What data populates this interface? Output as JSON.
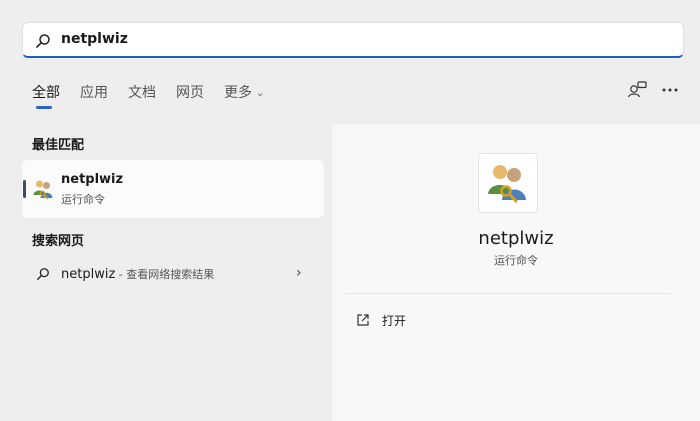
{
  "search": {
    "query": "netplwiz",
    "icon": "search-icon"
  },
  "tabs": [
    {
      "label": "全部",
      "active": true
    },
    {
      "label": "应用"
    },
    {
      "label": "文档"
    },
    {
      "label": "网页"
    },
    {
      "label": "更多",
      "chevron": "chevron-down-icon"
    }
  ],
  "toolbar": {
    "icons": [
      "accounts-icon",
      "more-options-icon"
    ]
  },
  "best_match": {
    "header": "最佳匹配",
    "item": {
      "title": "netplwiz",
      "subtitle": "运行命令",
      "icon": "user-accounts-icon"
    }
  },
  "web_search": {
    "header": "搜索网页",
    "item": {
      "query": "netplwiz",
      "suffix": " - 查看网络搜索结果",
      "icon": "search-icon",
      "chevron": "chevron-right-icon"
    }
  },
  "detail": {
    "title": "netplwiz",
    "subtitle": "运行命令",
    "icon": "user-accounts-icon",
    "actions": [
      {
        "label": "打开",
        "icon": "open-external-icon"
      }
    ]
  },
  "colors": {
    "accent": "#2f64c4",
    "background": "#eeeeee",
    "panel": "#f8f8f8"
  }
}
